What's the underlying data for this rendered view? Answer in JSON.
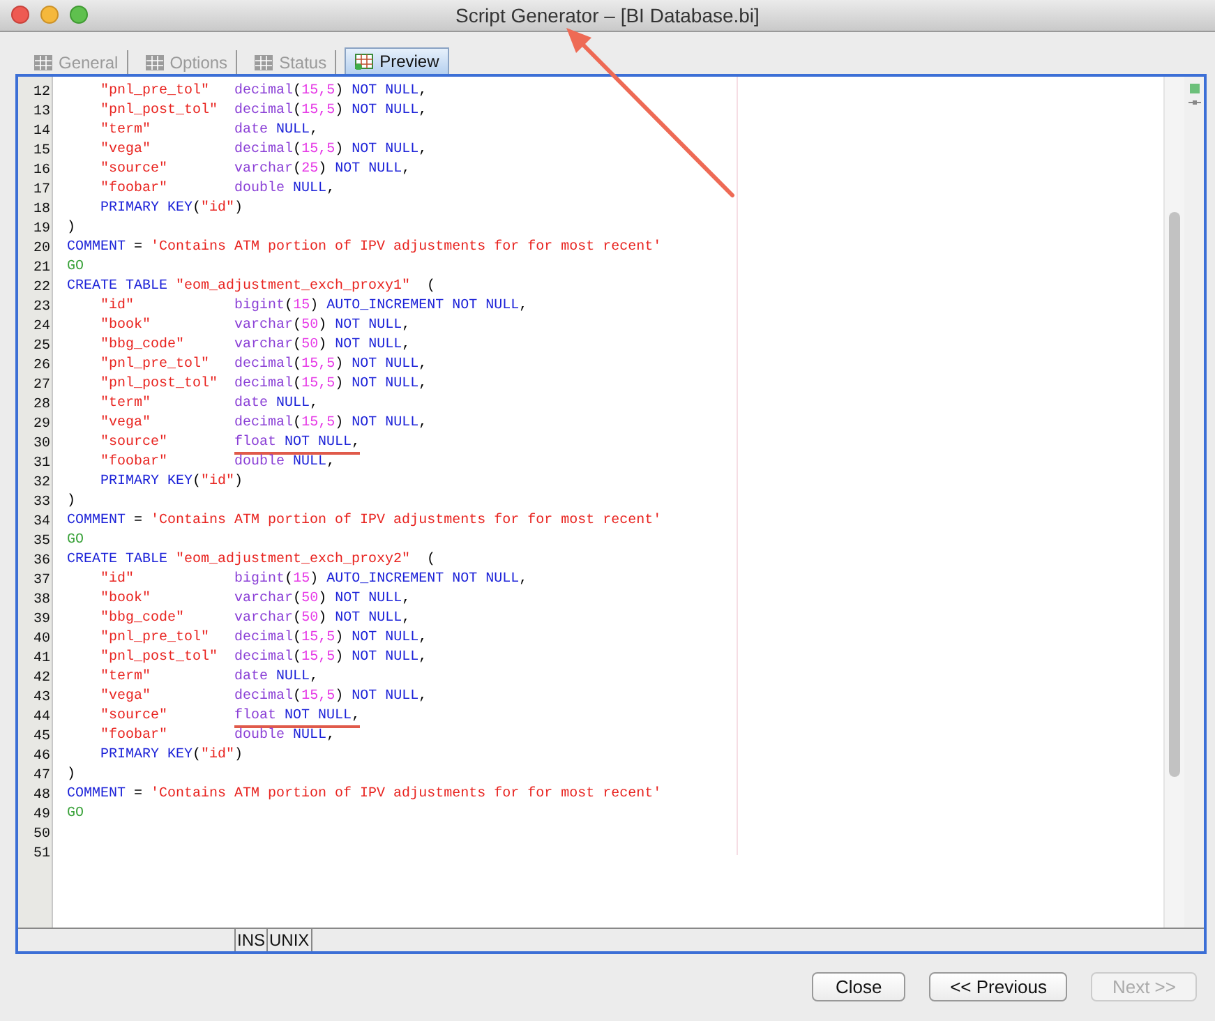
{
  "window": {
    "title": "Script Generator – [BI Database.bi]"
  },
  "tabs": [
    {
      "label": "General",
      "selected": false
    },
    {
      "label": "Options",
      "selected": false
    },
    {
      "label": "Status",
      "selected": false
    },
    {
      "label": "Preview",
      "selected": true
    }
  ],
  "editor": {
    "lines": [
      {
        "number": "12",
        "underlined": false,
        "tokens": [
          {
            "kind": "string",
            "text": "    \"pnl_pre_tol\"   "
          },
          {
            "kind": "type",
            "text": "decimal"
          },
          {
            "kind": "punct",
            "text": "("
          },
          {
            "kind": "number",
            "text": "15,5"
          },
          {
            "kind": "punct",
            "text": ") "
          },
          {
            "kind": "keyword",
            "text": "NOT NULL"
          },
          {
            "kind": "punct",
            "text": ","
          }
        ]
      },
      {
        "number": "13",
        "underlined": false,
        "tokens": [
          {
            "kind": "string",
            "text": "    \"pnl_post_tol\"  "
          },
          {
            "kind": "type",
            "text": "decimal"
          },
          {
            "kind": "punct",
            "text": "("
          },
          {
            "kind": "number",
            "text": "15,5"
          },
          {
            "kind": "punct",
            "text": ") "
          },
          {
            "kind": "keyword",
            "text": "NOT NULL"
          },
          {
            "kind": "punct",
            "text": ","
          }
        ]
      },
      {
        "number": "14",
        "underlined": false,
        "tokens": [
          {
            "kind": "string",
            "text": "    \"term\"          "
          },
          {
            "kind": "type",
            "text": "date "
          },
          {
            "kind": "keyword",
            "text": "NULL"
          },
          {
            "kind": "punct",
            "text": ","
          }
        ]
      },
      {
        "number": "15",
        "underlined": false,
        "tokens": [
          {
            "kind": "string",
            "text": "    \"vega\"          "
          },
          {
            "kind": "type",
            "text": "decimal"
          },
          {
            "kind": "punct",
            "text": "("
          },
          {
            "kind": "number",
            "text": "15,5"
          },
          {
            "kind": "punct",
            "text": ") "
          },
          {
            "kind": "keyword",
            "text": "NOT NULL"
          },
          {
            "kind": "punct",
            "text": ","
          }
        ]
      },
      {
        "number": "16",
        "underlined": false,
        "tokens": [
          {
            "kind": "string",
            "text": "    \"source\"        "
          },
          {
            "kind": "type",
            "text": "varchar"
          },
          {
            "kind": "punct",
            "text": "("
          },
          {
            "kind": "number",
            "text": "25"
          },
          {
            "kind": "punct",
            "text": ") "
          },
          {
            "kind": "keyword",
            "text": "NOT NULL"
          },
          {
            "kind": "punct",
            "text": ","
          }
        ]
      },
      {
        "number": "17",
        "underlined": false,
        "tokens": [
          {
            "kind": "string",
            "text": "    \"foobar\"        "
          },
          {
            "kind": "type",
            "text": "double "
          },
          {
            "kind": "keyword",
            "text": "NULL"
          },
          {
            "kind": "punct",
            "text": ","
          }
        ]
      },
      {
        "number": "18",
        "underlined": false,
        "tokens": [
          {
            "kind": "keyword",
            "text": "    PRIMARY KEY"
          },
          {
            "kind": "punct",
            "text": "("
          },
          {
            "kind": "string",
            "text": "\"id\""
          },
          {
            "kind": "punct",
            "text": ")"
          }
        ]
      },
      {
        "number": "19",
        "underlined": false,
        "tokens": [
          {
            "kind": "punct",
            "text": ")"
          }
        ]
      },
      {
        "number": "20",
        "underlined": false,
        "tokens": [
          {
            "kind": "keyword",
            "text": "COMMENT"
          },
          {
            "kind": "punct",
            "text": " = "
          },
          {
            "kind": "string",
            "text": "'Contains ATM portion of IPV adjustments for for most recent'"
          }
        ]
      },
      {
        "number": "21",
        "underlined": false,
        "tokens": [
          {
            "kind": "go",
            "text": "GO"
          }
        ]
      },
      {
        "number": "22",
        "underlined": false,
        "tokens": [
          {
            "kind": "keyword",
            "text": "CREATE TABLE "
          },
          {
            "kind": "string",
            "text": "\"eom_adjustment_exch_proxy1\""
          },
          {
            "kind": "punct",
            "text": "  ("
          }
        ]
      },
      {
        "number": "23",
        "underlined": false,
        "tokens": [
          {
            "kind": "string",
            "text": "    \"id\"            "
          },
          {
            "kind": "type",
            "text": "bigint"
          },
          {
            "kind": "punct",
            "text": "("
          },
          {
            "kind": "number",
            "text": "15"
          },
          {
            "kind": "punct",
            "text": ") "
          },
          {
            "kind": "keyword",
            "text": "AUTO_INCREMENT NOT NULL"
          },
          {
            "kind": "punct",
            "text": ","
          }
        ]
      },
      {
        "number": "24",
        "underlined": false,
        "tokens": [
          {
            "kind": "string",
            "text": "    \"book\"          "
          },
          {
            "kind": "type",
            "text": "varchar"
          },
          {
            "kind": "punct",
            "text": "("
          },
          {
            "kind": "number",
            "text": "50"
          },
          {
            "kind": "punct",
            "text": ") "
          },
          {
            "kind": "keyword",
            "text": "NOT NULL"
          },
          {
            "kind": "punct",
            "text": ","
          }
        ]
      },
      {
        "number": "25",
        "underlined": false,
        "tokens": [
          {
            "kind": "string",
            "text": "    \"bbg_code\"      "
          },
          {
            "kind": "type",
            "text": "varchar"
          },
          {
            "kind": "punct",
            "text": "("
          },
          {
            "kind": "number",
            "text": "50"
          },
          {
            "kind": "punct",
            "text": ") "
          },
          {
            "kind": "keyword",
            "text": "NOT NULL"
          },
          {
            "kind": "punct",
            "text": ","
          }
        ]
      },
      {
        "number": "26",
        "underlined": false,
        "tokens": [
          {
            "kind": "string",
            "text": "    \"pnl_pre_tol\"   "
          },
          {
            "kind": "type",
            "text": "decimal"
          },
          {
            "kind": "punct",
            "text": "("
          },
          {
            "kind": "number",
            "text": "15,5"
          },
          {
            "kind": "punct",
            "text": ") "
          },
          {
            "kind": "keyword",
            "text": "NOT NULL"
          },
          {
            "kind": "punct",
            "text": ","
          }
        ]
      },
      {
        "number": "27",
        "underlined": false,
        "tokens": [
          {
            "kind": "string",
            "text": "    \"pnl_post_tol\"  "
          },
          {
            "kind": "type",
            "text": "decimal"
          },
          {
            "kind": "punct",
            "text": "("
          },
          {
            "kind": "number",
            "text": "15,5"
          },
          {
            "kind": "punct",
            "text": ") "
          },
          {
            "kind": "keyword",
            "text": "NOT NULL"
          },
          {
            "kind": "punct",
            "text": ","
          }
        ]
      },
      {
        "number": "28",
        "underlined": false,
        "tokens": [
          {
            "kind": "string",
            "text": "    \"term\"          "
          },
          {
            "kind": "type",
            "text": "date "
          },
          {
            "kind": "keyword",
            "text": "NULL"
          },
          {
            "kind": "punct",
            "text": ","
          }
        ]
      },
      {
        "number": "29",
        "underlined": false,
        "tokens": [
          {
            "kind": "string",
            "text": "    \"vega\"          "
          },
          {
            "kind": "type",
            "text": "decimal"
          },
          {
            "kind": "punct",
            "text": "("
          },
          {
            "kind": "number",
            "text": "15,5"
          },
          {
            "kind": "punct",
            "text": ") "
          },
          {
            "kind": "keyword",
            "text": "NOT NULL"
          },
          {
            "kind": "punct",
            "text": ","
          }
        ]
      },
      {
        "number": "30",
        "underlined": true,
        "tokens": [
          {
            "kind": "string",
            "text": "    \"source\"        "
          },
          {
            "kind": "type",
            "text": "float "
          },
          {
            "kind": "keyword",
            "text": "NOT NULL"
          },
          {
            "kind": "punct",
            "text": ","
          }
        ]
      },
      {
        "number": "31",
        "underlined": false,
        "tokens": [
          {
            "kind": "string",
            "text": "    \"foobar\"        "
          },
          {
            "kind": "type",
            "text": "double "
          },
          {
            "kind": "keyword",
            "text": "NULL"
          },
          {
            "kind": "punct",
            "text": ","
          }
        ]
      },
      {
        "number": "32",
        "underlined": false,
        "tokens": [
          {
            "kind": "keyword",
            "text": "    PRIMARY KEY"
          },
          {
            "kind": "punct",
            "text": "("
          },
          {
            "kind": "string",
            "text": "\"id\""
          },
          {
            "kind": "punct",
            "text": ")"
          }
        ]
      },
      {
        "number": "33",
        "underlined": false,
        "tokens": [
          {
            "kind": "punct",
            "text": ")"
          }
        ]
      },
      {
        "number": "34",
        "underlined": false,
        "tokens": [
          {
            "kind": "keyword",
            "text": "COMMENT"
          },
          {
            "kind": "punct",
            "text": " = "
          },
          {
            "kind": "string",
            "text": "'Contains ATM portion of IPV adjustments for for most recent'"
          }
        ]
      },
      {
        "number": "35",
        "underlined": false,
        "tokens": [
          {
            "kind": "go",
            "text": "GO"
          }
        ]
      },
      {
        "number": "36",
        "underlined": false,
        "tokens": [
          {
            "kind": "keyword",
            "text": "CREATE TABLE "
          },
          {
            "kind": "string",
            "text": "\"eom_adjustment_exch_proxy2\""
          },
          {
            "kind": "punct",
            "text": "  ("
          }
        ]
      },
      {
        "number": "37",
        "underlined": false,
        "tokens": [
          {
            "kind": "string",
            "text": "    \"id\"            "
          },
          {
            "kind": "type",
            "text": "bigint"
          },
          {
            "kind": "punct",
            "text": "("
          },
          {
            "kind": "number",
            "text": "15"
          },
          {
            "kind": "punct",
            "text": ") "
          },
          {
            "kind": "keyword",
            "text": "AUTO_INCREMENT NOT NULL"
          },
          {
            "kind": "punct",
            "text": ","
          }
        ]
      },
      {
        "number": "38",
        "underlined": false,
        "tokens": [
          {
            "kind": "string",
            "text": "    \"book\"          "
          },
          {
            "kind": "type",
            "text": "varchar"
          },
          {
            "kind": "punct",
            "text": "("
          },
          {
            "kind": "number",
            "text": "50"
          },
          {
            "kind": "punct",
            "text": ") "
          },
          {
            "kind": "keyword",
            "text": "NOT NULL"
          },
          {
            "kind": "punct",
            "text": ","
          }
        ]
      },
      {
        "number": "39",
        "underlined": false,
        "tokens": [
          {
            "kind": "string",
            "text": "    \"bbg_code\"      "
          },
          {
            "kind": "type",
            "text": "varchar"
          },
          {
            "kind": "punct",
            "text": "("
          },
          {
            "kind": "number",
            "text": "50"
          },
          {
            "kind": "punct",
            "text": ") "
          },
          {
            "kind": "keyword",
            "text": "NOT NULL"
          },
          {
            "kind": "punct",
            "text": ","
          }
        ]
      },
      {
        "number": "40",
        "underlined": false,
        "tokens": [
          {
            "kind": "string",
            "text": "    \"pnl_pre_tol\"   "
          },
          {
            "kind": "type",
            "text": "decimal"
          },
          {
            "kind": "punct",
            "text": "("
          },
          {
            "kind": "number",
            "text": "15,5"
          },
          {
            "kind": "punct",
            "text": ") "
          },
          {
            "kind": "keyword",
            "text": "NOT NULL"
          },
          {
            "kind": "punct",
            "text": ","
          }
        ]
      },
      {
        "number": "41",
        "underlined": false,
        "tokens": [
          {
            "kind": "string",
            "text": "    \"pnl_post_tol\"  "
          },
          {
            "kind": "type",
            "text": "decimal"
          },
          {
            "kind": "punct",
            "text": "("
          },
          {
            "kind": "number",
            "text": "15,5"
          },
          {
            "kind": "punct",
            "text": ") "
          },
          {
            "kind": "keyword",
            "text": "NOT NULL"
          },
          {
            "kind": "punct",
            "text": ","
          }
        ]
      },
      {
        "number": "42",
        "underlined": false,
        "tokens": [
          {
            "kind": "string",
            "text": "    \"term\"          "
          },
          {
            "kind": "type",
            "text": "date "
          },
          {
            "kind": "keyword",
            "text": "NULL"
          },
          {
            "kind": "punct",
            "text": ","
          }
        ]
      },
      {
        "number": "43",
        "underlined": false,
        "tokens": [
          {
            "kind": "string",
            "text": "    \"vega\"          "
          },
          {
            "kind": "type",
            "text": "decimal"
          },
          {
            "kind": "punct",
            "text": "("
          },
          {
            "kind": "number",
            "text": "15,5"
          },
          {
            "kind": "punct",
            "text": ") "
          },
          {
            "kind": "keyword",
            "text": "NOT NULL"
          },
          {
            "kind": "punct",
            "text": ","
          }
        ]
      },
      {
        "number": "44",
        "underlined": true,
        "tokens": [
          {
            "kind": "string",
            "text": "    \"source\"        "
          },
          {
            "kind": "type",
            "text": "float "
          },
          {
            "kind": "keyword",
            "text": "NOT NULL"
          },
          {
            "kind": "punct",
            "text": ","
          }
        ]
      },
      {
        "number": "45",
        "underlined": false,
        "tokens": [
          {
            "kind": "string",
            "text": "    \"foobar\"        "
          },
          {
            "kind": "type",
            "text": "double "
          },
          {
            "kind": "keyword",
            "text": "NULL"
          },
          {
            "kind": "punct",
            "text": ","
          }
        ]
      },
      {
        "number": "46",
        "underlined": false,
        "tokens": [
          {
            "kind": "keyword",
            "text": "    PRIMARY KEY"
          },
          {
            "kind": "punct",
            "text": "("
          },
          {
            "kind": "string",
            "text": "\"id\""
          },
          {
            "kind": "punct",
            "text": ")"
          }
        ]
      },
      {
        "number": "47",
        "underlined": false,
        "tokens": [
          {
            "kind": "punct",
            "text": ")"
          }
        ]
      },
      {
        "number": "48",
        "underlined": false,
        "tokens": [
          {
            "kind": "keyword",
            "text": "COMMENT"
          },
          {
            "kind": "punct",
            "text": " = "
          },
          {
            "kind": "string",
            "text": "'Contains ATM portion of IPV adjustments for for most recent'"
          }
        ]
      },
      {
        "number": "49",
        "underlined": false,
        "tokens": [
          {
            "kind": "go",
            "text": "GO"
          }
        ]
      },
      {
        "number": "50",
        "underlined": false
      },
      {
        "number": "51",
        "underlined": false
      }
    ]
  },
  "status_bar": {
    "mode": "INS",
    "line_ending": "UNIX"
  },
  "buttons": [
    {
      "label": "Close",
      "disabled": false
    },
    {
      "label": "<< Previous",
      "disabled": false
    },
    {
      "label": "Next >>",
      "disabled": true
    }
  ]
}
